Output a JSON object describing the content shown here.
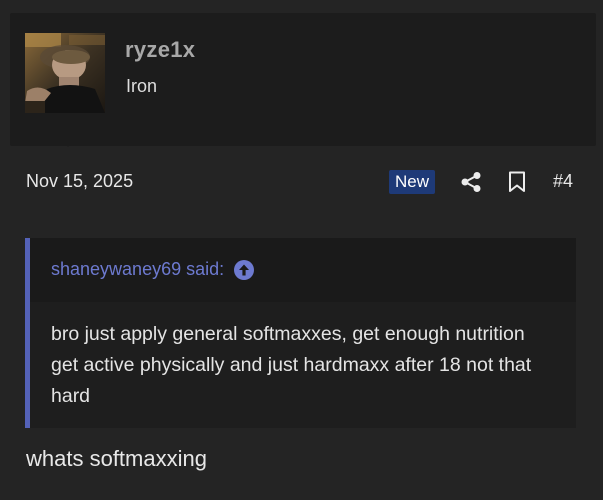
{
  "user": {
    "name": "ryze1x",
    "title": "Iron"
  },
  "post": {
    "date": "Nov 15, 2025",
    "badge": "New",
    "number": "#4",
    "body": "whats softmaxxing"
  },
  "quote": {
    "author": "shaneywaney69 said:",
    "text": "bro just apply general softmaxxes, get enough nutrition get active physically and just hardmaxx after 18 not that hard"
  },
  "icons": {
    "share": "share-icon",
    "bookmark": "bookmark-icon",
    "quote_jump": "arrow-up-circle-icon"
  },
  "colors": {
    "background": "#242424",
    "card": "#1c1c1c",
    "accent": "#5462b8",
    "link": "#6d7ad0",
    "badge": "#1e3a78"
  }
}
